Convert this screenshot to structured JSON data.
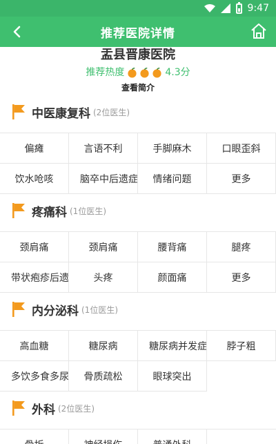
{
  "status_bar": {
    "time": "9:47"
  },
  "app_bar": {
    "title": "推荐医院详情",
    "back_icon": "back-arrow-icon",
    "home_icon": "home-icon"
  },
  "hospital": {
    "name": "盂县晋康医院",
    "rating_label": "推荐热度",
    "rating_score": "4.3分",
    "rating_icons": 3,
    "intro_link": "查看简介"
  },
  "colors": {
    "primary": "#3fbf6f",
    "accent_orange": "#f39a1e"
  },
  "departments": [
    {
      "name": "中医康复科",
      "count": "(2位医生)",
      "items": [
        "偏瘫",
        "言语不利",
        "手脚麻木",
        "口眼歪斜",
        "饮水呛咳",
        "脑卒中后遗症",
        "情绪问题",
        "更多"
      ]
    },
    {
      "name": "疼痛科",
      "count": "(1位医生)",
      "items": [
        "颈肩痛",
        "颈肩痛",
        "腰背痛",
        "腿疼",
        "带状疱疹后遗",
        "头疼",
        "颜面痛",
        "更多"
      ]
    },
    {
      "name": "内分泌科",
      "count": "(1位医生)",
      "items": [
        "高血糖",
        "糖尿病",
        "糖尿病并发症",
        "脖子粗",
        "多饮多食多尿",
        "骨质疏松",
        "眼球突出"
      ]
    },
    {
      "name": "外科",
      "count": "(2位医生)",
      "items": [
        "骨折",
        "神经损伤",
        "普通外科"
      ]
    }
  ]
}
